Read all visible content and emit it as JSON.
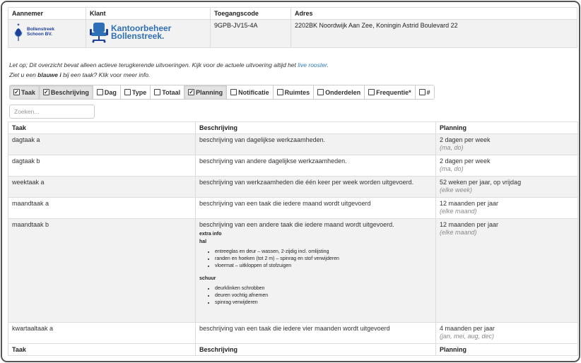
{
  "info": {
    "headers": [
      "Aannemer",
      "Klant",
      "Toegangscode",
      "Adres"
    ],
    "contractor_logo_text": [
      "Bollenstreek",
      "Schoon BV."
    ],
    "client_logo_text": [
      "Kantoorbeheer",
      "Bollenstreek."
    ],
    "access_code": "9GPB-JV15-4A",
    "address": "2202BK Noordwijk Aan Zee, Koningin Astrid Boulevard 22"
  },
  "notice": {
    "line1_pre": "Let op; Dit overzicht bevat alleen actieve terugkerende uitvoeringen. Kijk voor de actuele uitvoering altijd het ",
    "line1_link": "live rooster",
    "line1_post": ".",
    "line2_pre": "Ziet u een ",
    "line2_bold": "blauwe i",
    "line2_post": " bij een taak? Klik voor meer info."
  },
  "toggles": [
    {
      "label": "Taak",
      "checked": true
    },
    {
      "label": "Beschrijving",
      "checked": true
    },
    {
      "label": "Dag",
      "checked": false
    },
    {
      "label": "Type",
      "checked": false
    },
    {
      "label": "Totaal",
      "checked": false
    },
    {
      "label": "Planning",
      "checked": true
    },
    {
      "label": "Notificatie",
      "checked": false
    },
    {
      "label": "Ruimtes",
      "checked": false
    },
    {
      "label": "Onderdelen",
      "checked": false
    },
    {
      "label": "Frequentie*",
      "checked": false
    },
    {
      "label": "#",
      "checked": false
    }
  ],
  "search": {
    "placeholder": "Zoeken..."
  },
  "table": {
    "columns": [
      "Taak",
      "Beschrijving",
      "Planning"
    ],
    "rows": [
      {
        "task": "dagtaak a",
        "desc": "beschrijving van dagelijkse werkzaamheden.",
        "plan": "2 dagen per week",
        "plan_sub": "(ma, do)"
      },
      {
        "task": "dagtaak b",
        "desc": "beschrijving van andere dagelijkse werkzaamheden.",
        "plan": "2 dagen per week",
        "plan_sub": "(ma, do)"
      },
      {
        "task": "weektaak a",
        "desc": "beschrijving van werkzaamheden die één keer per week worden uitgevoerd.",
        "plan": "52 weken per jaar, op vrijdag",
        "plan_sub": "(elke week)"
      },
      {
        "task": "maandtaak a",
        "desc": "beschrijving van een taak die iedere maand wordt uitgevoerd",
        "plan": "12 maanden per jaar",
        "plan_sub": "(elke maand)"
      },
      {
        "task": "maandtaak b",
        "desc": "beschrijving van een andere taak die iedere maand wordt uitgevoerd.",
        "plan": "12 maanden per jaar",
        "plan_sub": "(elke maand)",
        "extra": {
          "title": "extra info",
          "sections": [
            {
              "heading": "hal",
              "items": [
                "entreeglas en deur – wassen, 2-zijdig incl. omlijsting",
                "randen en hoeken (tot 2 m) – spinrag en stof verwijderen",
                "vloermat – uitkloppen of stofzuigen"
              ]
            },
            {
              "heading": "schuur",
              "items": [
                "deurklinken schrobben",
                "deuren vochtig afnemen",
                "spinrag verwijderen"
              ]
            }
          ]
        }
      },
      {
        "task": "kwartaaltaak a",
        "desc": "beschrijving van een taak die iedere vier maanden wordt uitgevoerd",
        "plan": "4 maanden per jaar",
        "plan_sub": "(jan, mei, aug, dec)"
      }
    ]
  },
  "colors": {
    "link": "#2a7ab8",
    "logo_blue": "#1d3f97",
    "logo_light_blue": "#2f6fb6",
    "row_stripe": "#f2f2f2"
  }
}
